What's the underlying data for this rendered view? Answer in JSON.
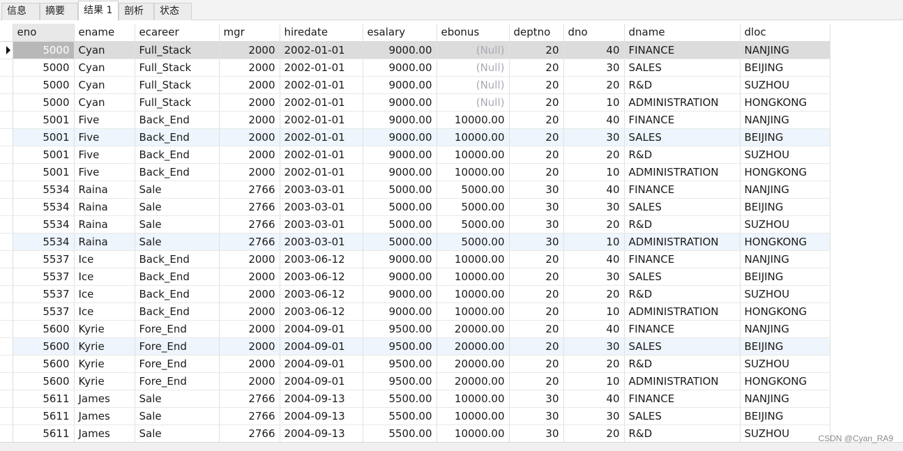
{
  "tabs": [
    {
      "label": "信息"
    },
    {
      "label": "摘要"
    },
    {
      "label": "结果 1"
    },
    {
      "label": "剖析"
    },
    {
      "label": "状态"
    }
  ],
  "grid": {
    "columns": [
      "eno",
      "ename",
      "ecareer",
      "mgr",
      "hiredate",
      "esalary",
      "ebonus",
      "deptno",
      "dno",
      "dname",
      "dloc"
    ],
    "rows": [
      [
        "5000",
        "Cyan",
        "Full_Stack",
        "2000",
        "2002-01-01",
        "9000.00",
        "(Null)",
        "20",
        "40",
        "FINANCE",
        "NANJING"
      ],
      [
        "5000",
        "Cyan",
        "Full_Stack",
        "2000",
        "2002-01-01",
        "9000.00",
        "(Null)",
        "20",
        "30",
        "SALES",
        "BEIJING"
      ],
      [
        "5000",
        "Cyan",
        "Full_Stack",
        "2000",
        "2002-01-01",
        "9000.00",
        "(Null)",
        "20",
        "20",
        "R&D",
        "SUZHOU"
      ],
      [
        "5000",
        "Cyan",
        "Full_Stack",
        "2000",
        "2002-01-01",
        "9000.00",
        "(Null)",
        "20",
        "10",
        "ADMINISTRATION",
        "HONGKONG"
      ],
      [
        "5001",
        "Five",
        "Back_End",
        "2000",
        "2002-01-01",
        "9000.00",
        "10000.00",
        "20",
        "40",
        "FINANCE",
        "NANJING"
      ],
      [
        "5001",
        "Five",
        "Back_End",
        "2000",
        "2002-01-01",
        "9000.00",
        "10000.00",
        "20",
        "30",
        "SALES",
        "BEIJING"
      ],
      [
        "5001",
        "Five",
        "Back_End",
        "2000",
        "2002-01-01",
        "9000.00",
        "10000.00",
        "20",
        "20",
        "R&D",
        "SUZHOU"
      ],
      [
        "5001",
        "Five",
        "Back_End",
        "2000",
        "2002-01-01",
        "9000.00",
        "10000.00",
        "20",
        "10",
        "ADMINISTRATION",
        "HONGKONG"
      ],
      [
        "5534",
        "Raina",
        "Sale",
        "2766",
        "2003-03-01",
        "5000.00",
        "5000.00",
        "30",
        "40",
        "FINANCE",
        "NANJING"
      ],
      [
        "5534",
        "Raina",
        "Sale",
        "2766",
        "2003-03-01",
        "5000.00",
        "5000.00",
        "30",
        "30",
        "SALES",
        "BEIJING"
      ],
      [
        "5534",
        "Raina",
        "Sale",
        "2766",
        "2003-03-01",
        "5000.00",
        "5000.00",
        "30",
        "20",
        "R&D",
        "SUZHOU"
      ],
      [
        "5534",
        "Raina",
        "Sale",
        "2766",
        "2003-03-01",
        "5000.00",
        "5000.00",
        "30",
        "10",
        "ADMINISTRATION",
        "HONGKONG"
      ],
      [
        "5537",
        "Ice",
        "Back_End",
        "2000",
        "2003-06-12",
        "9000.00",
        "10000.00",
        "20",
        "40",
        "FINANCE",
        "NANJING"
      ],
      [
        "5537",
        "Ice",
        "Back_End",
        "2000",
        "2003-06-12",
        "9000.00",
        "10000.00",
        "20",
        "30",
        "SALES",
        "BEIJING"
      ],
      [
        "5537",
        "Ice",
        "Back_End",
        "2000",
        "2003-06-12",
        "9000.00",
        "10000.00",
        "20",
        "20",
        "R&D",
        "SUZHOU"
      ],
      [
        "5537",
        "Ice",
        "Back_End",
        "2000",
        "2003-06-12",
        "9000.00",
        "10000.00",
        "20",
        "10",
        "ADMINISTRATION",
        "HONGKONG"
      ],
      [
        "5600",
        "Kyrie",
        "Fore_End",
        "2000",
        "2004-09-01",
        "9500.00",
        "20000.00",
        "20",
        "40",
        "FINANCE",
        "NANJING"
      ],
      [
        "5600",
        "Kyrie",
        "Fore_End",
        "2000",
        "2004-09-01",
        "9500.00",
        "20000.00",
        "20",
        "30",
        "SALES",
        "BEIJING"
      ],
      [
        "5600",
        "Kyrie",
        "Fore_End",
        "2000",
        "2004-09-01",
        "9500.00",
        "20000.00",
        "20",
        "20",
        "R&D",
        "SUZHOU"
      ],
      [
        "5600",
        "Kyrie",
        "Fore_End",
        "2000",
        "2004-09-01",
        "9500.00",
        "20000.00",
        "20",
        "10",
        "ADMINISTRATION",
        "HONGKONG"
      ],
      [
        "5611",
        "James",
        "Sale",
        "2766",
        "2004-09-13",
        "5500.00",
        "10000.00",
        "30",
        "40",
        "FINANCE",
        "NANJING"
      ],
      [
        "5611",
        "James",
        "Sale",
        "2766",
        "2004-09-13",
        "5500.00",
        "10000.00",
        "30",
        "30",
        "SALES",
        "BEIJING"
      ],
      [
        "5611",
        "James",
        "Sale",
        "2766",
        "2004-09-13",
        "5500.00",
        "10000.00",
        "30",
        "20",
        "R&D",
        "SUZHOU"
      ]
    ]
  },
  "watermark": "CSDN @Cyan_RA9"
}
